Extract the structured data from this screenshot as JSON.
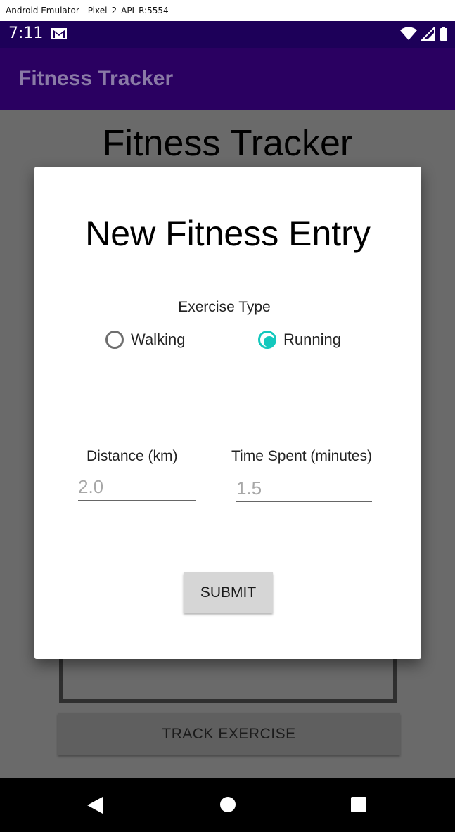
{
  "window": {
    "title": "Android Emulator - Pixel_2_API_R:5554"
  },
  "status_bar": {
    "time": "7:11"
  },
  "app_bar": {
    "title": "Fitness Tracker"
  },
  "background": {
    "heading": "Fitness Tracker",
    "track_button_label": "TRACK EXERCISE"
  },
  "dialog": {
    "title": "New Fitness Entry",
    "exercise_type_label": "Exercise Type",
    "radios": [
      {
        "label": "Walking",
        "checked": false
      },
      {
        "label": "Running",
        "checked": true
      }
    ],
    "distance": {
      "label": "Distance (km)",
      "placeholder": "2.0",
      "value": ""
    },
    "time": {
      "label": "Time Spent (minutes)",
      "placeholder": "1.5",
      "value": ""
    },
    "submit_label": "SUBMIT"
  },
  "colors": {
    "status_bar": "#1d0059",
    "app_bar": "#2a0061",
    "radio_accent": "#14c8bd",
    "scrim": "#6a6a6a"
  },
  "icons": {
    "status": [
      "gmail-icon",
      "wifi-icon",
      "signal-icon",
      "battery-icon"
    ],
    "nav": [
      "back-icon",
      "home-icon",
      "recent-apps-icon"
    ]
  }
}
